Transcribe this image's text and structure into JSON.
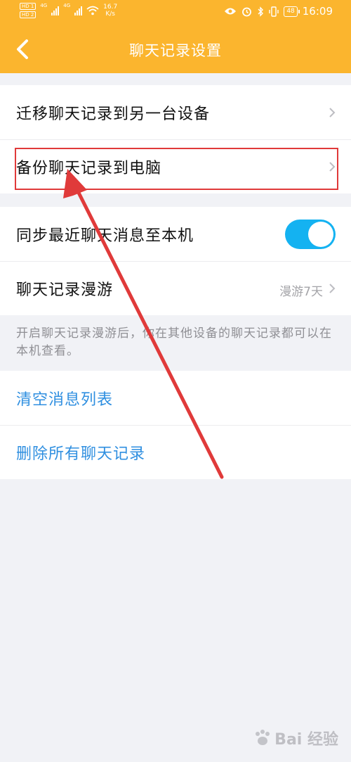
{
  "status_bar": {
    "hd1": "HD 1",
    "hd2": "HD 2",
    "net1": "4G",
    "net2": "4G",
    "speed_value": "16.7",
    "speed_unit": "K/s",
    "battery": "48",
    "time": "16:09"
  },
  "nav": {
    "title": "聊天记录设置",
    "back_icon": "chevron-left-icon"
  },
  "section1": {
    "items": [
      {
        "label": "迁移聊天记录到另一台设备"
      },
      {
        "label": "备份聊天记录到电脑"
      }
    ]
  },
  "section2": {
    "sync_label": "同步最近聊天消息至本机",
    "sync_enabled": true,
    "roam_label": "聊天记录漫游",
    "roam_value": "漫游7天"
  },
  "hint": "开启聊天记录漫游后，你在其他设备的聊天记录都可以在本机查看。",
  "section3": {
    "clear_label": "清空消息列表",
    "delete_label": "删除所有聊天记录"
  },
  "watermark": "Bai 经验",
  "colors": {
    "header": "#fbb52e",
    "toggle_on": "#14b2f1",
    "link_blue": "#2f8fe0",
    "annotation_red": "#e03a3a",
    "background": "#f1f2f6"
  }
}
